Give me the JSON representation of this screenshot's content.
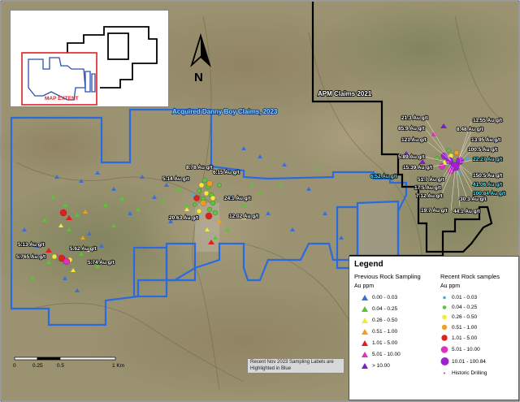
{
  "inset": {
    "extent_label": "MAP EXTENT"
  },
  "north": {
    "label": "N"
  },
  "claims": {
    "apm": "APM Claims 2021",
    "danny_boy": "Acquired Danny Boy Claims, 2023"
  },
  "sample_labels": [
    "8.78 Au g/t",
    "6.15 Au g/t",
    "5.14 Au g/t",
    "24.1 Au g/t",
    "20.63 Au g/t",
    "12.02 Au g/t",
    "5.13 Au g/t",
    "5.62 Au g/t",
    "5.765 Au g/t",
    "5.74 Au g/t",
    "21.3 Au g/t",
    "85.9 Au g/t",
    "121 Au g/t",
    "5.89 Au g/t",
    "15.39 Au g/t",
    "6.52 Au g/t",
    "51.7 Au g/t",
    "17.5 Au g/t",
    "7.12 Au g/t",
    "19.7 Au g/t",
    "44.1 Au g/t",
    "30.3 Au g/t",
    "11.55 Au g/t",
    "8.48 Au g/t",
    "13.95 Au g/t",
    "100.5 Au g/t",
    "22.27 Au g/t",
    "150.5 Au g/t",
    "41.06 Au g/t",
    "100.84 Au g/t"
  ],
  "scale": {
    "ticks": [
      "0",
      "0.25",
      "0.5",
      "1 Km"
    ]
  },
  "note": "Recent Nov 2023 Sampling Labels are Highlighted in Blue",
  "legend": {
    "title": "Legend",
    "previous_header": "Previous Rock Sampling",
    "recent_header": "Recent Rock samples",
    "unit_left": "Au ppm",
    "unit_right": "Au ppm",
    "previous": [
      {
        "label": "0.00 - 0.03",
        "color": "#3a6fd8"
      },
      {
        "label": "0.04 - 0.25",
        "color": "#5cc23a"
      },
      {
        "label": "0.26 - 0.50",
        "color": "#f2ea3a"
      },
      {
        "label": "0.51 - 1.00",
        "color": "#f0a020"
      },
      {
        "label": "1.01 - 5.00",
        "color": "#e02020"
      },
      {
        "label": "5.01 - 10.00",
        "color": "#e030c0"
      },
      {
        "label": "> 10.00",
        "color": "#7a20c0"
      }
    ],
    "recent": [
      {
        "label": "0.01 - 0.03",
        "color": "#3ab0d8"
      },
      {
        "label": "0.04 - 0.25",
        "color": "#5cc23a"
      },
      {
        "label": "0.26 - 0.50",
        "color": "#f2ea3a"
      },
      {
        "label": "0.51 - 1.00",
        "color": "#f0a020"
      },
      {
        "label": "1.01 - 5.00",
        "color": "#e02020"
      },
      {
        "label": "5.01 - 10.00",
        "color": "#e030c0"
      },
      {
        "label": "10.01 - 100.84",
        "color": "#a020d0"
      },
      {
        "label": "Historic Drilling",
        "color": "#666666"
      }
    ]
  },
  "colors": {
    "claims_blue": "#2a6ae0",
    "apm_black": "#000000",
    "extent_red": "#e02020"
  }
}
